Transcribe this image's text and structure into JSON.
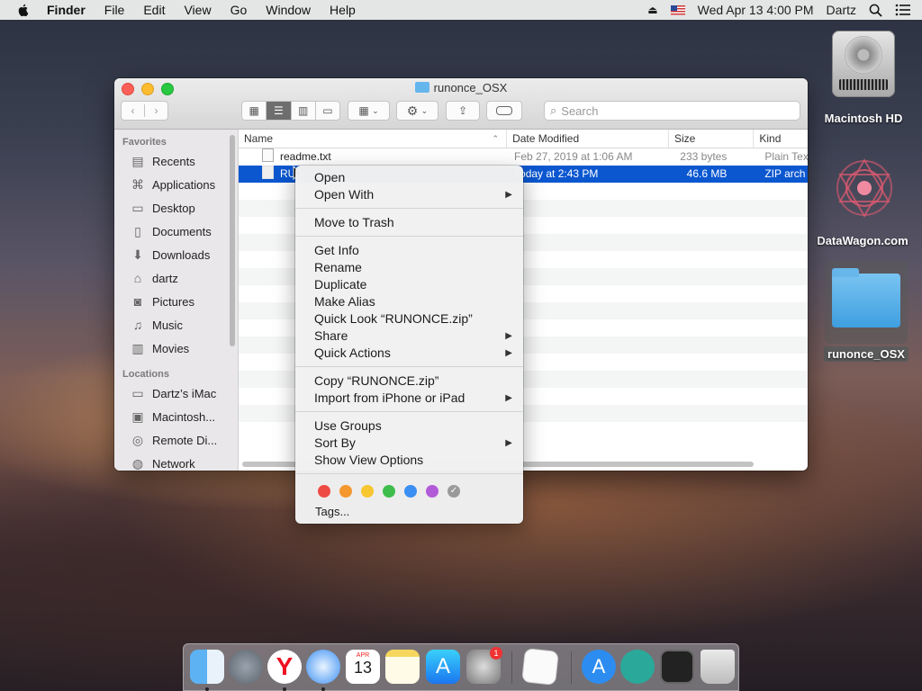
{
  "menubar": {
    "items": [
      "Finder",
      "File",
      "Edit",
      "View",
      "Go",
      "Window",
      "Help"
    ],
    "clock": "Wed Apr 13  4:00 PM",
    "user": "Dartz"
  },
  "desktop": {
    "icons": [
      "Macintosh HD",
      "DataWagon.com",
      "runonce_OSX"
    ]
  },
  "window": {
    "title": "runonce_OSX",
    "search_placeholder": "Search",
    "sidebar": {
      "favorites_header": "Favorites",
      "favorites": [
        "Recents",
        "Applications",
        "Desktop",
        "Documents",
        "Downloads",
        "dartz",
        "Pictures",
        "Music",
        "Movies"
      ],
      "locations_header": "Locations",
      "locations": [
        "Dartz’s iMac",
        "Macintosh...",
        "Remote Di...",
        "Network"
      ]
    },
    "columns": [
      "Name",
      "Date Modified",
      "Size",
      "Kind"
    ],
    "rows": [
      {
        "name": "readme.txt",
        "date": "Feb 27, 2019 at 1:06 AM",
        "size": "233 bytes",
        "kind": "Plain Tex"
      },
      {
        "name": "RU",
        "date": "Today at 2:43 PM",
        "size": "46.6 MB",
        "kind": "ZIP arch"
      }
    ]
  },
  "context_menu": {
    "group1": [
      {
        "label": "Open",
        "sub": false
      },
      {
        "label": "Open With",
        "sub": true
      }
    ],
    "group2": [
      {
        "label": "Move to Trash",
        "sub": false
      }
    ],
    "group3": [
      {
        "label": "Get Info",
        "sub": false
      },
      {
        "label": "Rename",
        "sub": false
      },
      {
        "label": "Duplicate",
        "sub": false
      },
      {
        "label": "Make Alias",
        "sub": false
      },
      {
        "label": "Quick Look “RUNONCE.zip”",
        "sub": false
      },
      {
        "label": "Share",
        "sub": true
      },
      {
        "label": "Quick Actions",
        "sub": true
      }
    ],
    "group4": [
      {
        "label": "Copy “RUNONCE.zip”",
        "sub": false
      },
      {
        "label": "Import from iPhone or iPad",
        "sub": true
      }
    ],
    "group5": [
      {
        "label": "Use Groups",
        "sub": false
      },
      {
        "label": "Sort By",
        "sub": true
      },
      {
        "label": "Show View Options",
        "sub": false
      }
    ],
    "tag_colors": [
      "#ee4b44",
      "#f4982f",
      "#f7c630",
      "#3fbd4c",
      "#3b8ff3",
      "#b25bd9",
      "#9a9a9a"
    ],
    "tags_label": "Tags..."
  },
  "dock": {
    "calendar_month": "APR",
    "calendar_day": "13",
    "badge": "1"
  }
}
